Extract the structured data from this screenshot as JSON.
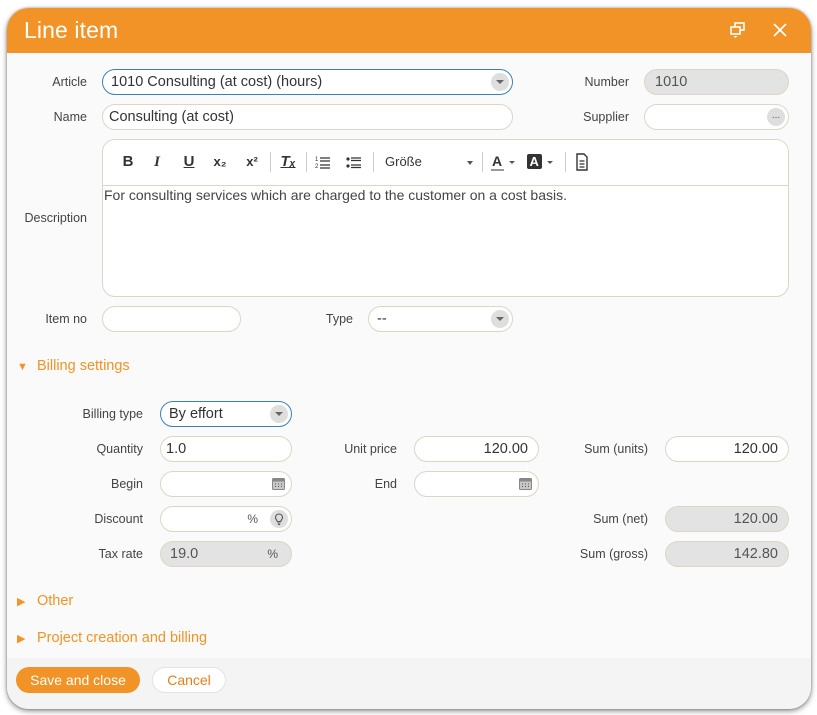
{
  "dialog": {
    "title": "Line item",
    "restore_icon": "restore-window-icon",
    "close_icon": "close-icon"
  },
  "header_fields": {
    "article": {
      "label": "Article",
      "value": "1010 Consulting (at cost) (hours)"
    },
    "number": {
      "label": "Number",
      "value": "1010"
    },
    "name": {
      "label": "Name",
      "value": "Consulting (at cost)"
    },
    "supplier": {
      "label": "Supplier",
      "value": "",
      "button": "..."
    },
    "description": {
      "label": "Description",
      "value": "For consulting services which are charged to the customer on a cost basis."
    },
    "item_no": {
      "label": "Item no",
      "value": ""
    },
    "type": {
      "label": "Type",
      "value": "--"
    }
  },
  "editor_toolbar": {
    "bold": "B",
    "italic": "I",
    "underline": "U",
    "subscript": "x₂",
    "superscript": "x²",
    "clear_format": "Tₓ",
    "size_label": "Größe"
  },
  "sections": {
    "billing": {
      "label": "Billing settings",
      "expanded": true
    },
    "other": {
      "label": "Other",
      "expanded": false
    },
    "project": {
      "label": "Project creation and billing",
      "expanded": false
    }
  },
  "billing": {
    "billing_type": {
      "label": "Billing type",
      "value": "By effort"
    },
    "quantity": {
      "label": "Quantity",
      "value": "1.0"
    },
    "unit_price": {
      "label": "Unit price",
      "value": "120.00"
    },
    "sum_units": {
      "label": "Sum (units)",
      "value": "120.00"
    },
    "begin": {
      "label": "Begin",
      "value": ""
    },
    "end": {
      "label": "End",
      "value": ""
    },
    "discount": {
      "label": "Discount",
      "value": "",
      "unit": "%"
    },
    "sum_net": {
      "label": "Sum (net)",
      "value": "120.00"
    },
    "tax_rate": {
      "label": "Tax rate",
      "value": "19.0",
      "unit": "%"
    },
    "sum_gross": {
      "label": "Sum (gross)",
      "value": "142.80"
    }
  },
  "footer": {
    "save_label": "Save and close",
    "cancel_label": "Cancel"
  },
  "colors": {
    "accent": "#f19326",
    "focus_border": "#3d80b8",
    "readonly_bg": "#e3e3e3"
  }
}
